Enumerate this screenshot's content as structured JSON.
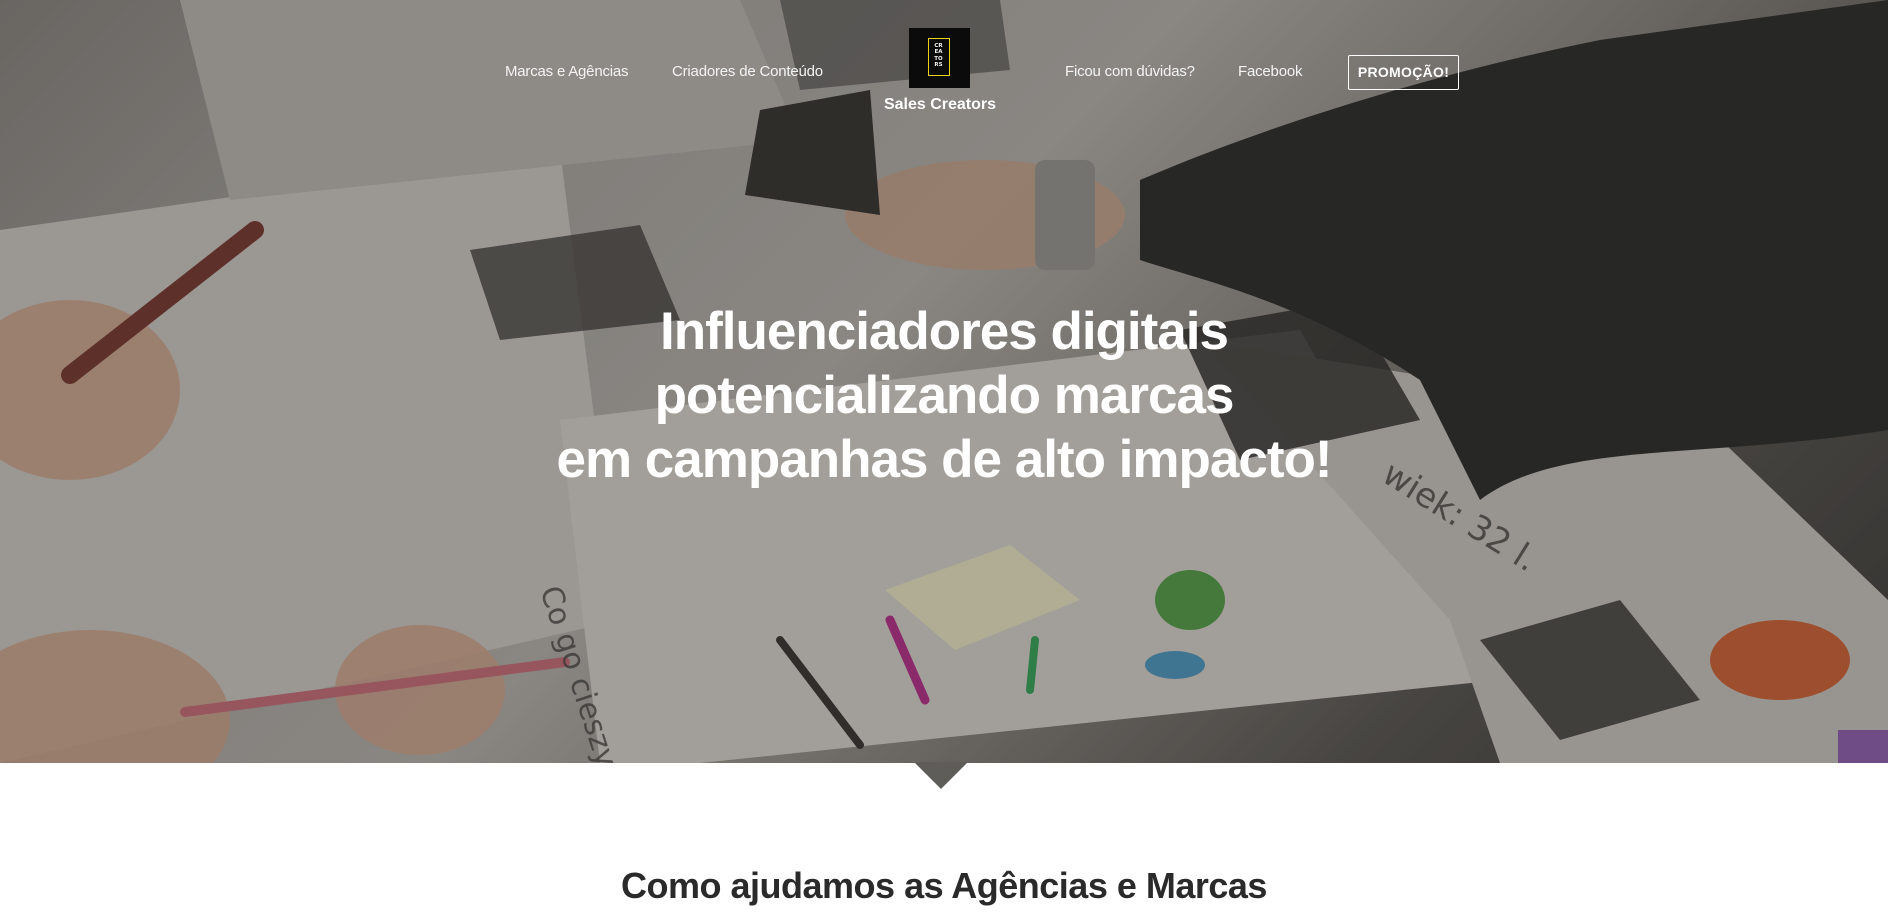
{
  "nav": {
    "left_links": [
      {
        "label": "Marcas e Agências"
      },
      {
        "label": "Criadores de Conteúdo"
      }
    ],
    "right_links": [
      {
        "label": "Ficou com dúvidas?"
      },
      {
        "label": "Facebook"
      }
    ],
    "promo_button": "PROMOÇÃO!"
  },
  "brand": {
    "name": "Sales Creators",
    "logo_letters": [
      "CR",
      "EA",
      "TO",
      "RS"
    ],
    "logo_border_color": "#e8d21a"
  },
  "hero": {
    "headline_lines": [
      "Influenciadores digitais",
      "potencializando marcas",
      "em campanhas de alto impacto!"
    ]
  },
  "section": {
    "title": "Como ajudamos as Agências e Marcas"
  }
}
